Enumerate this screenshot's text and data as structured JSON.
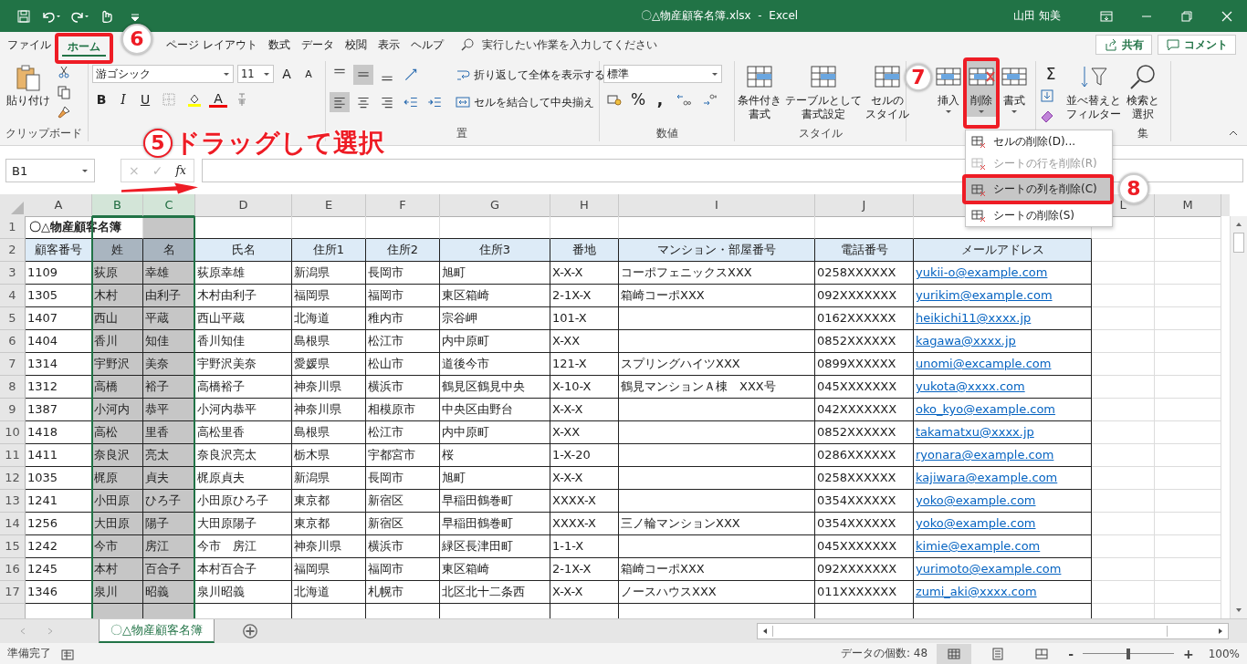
{
  "window": {
    "title": "〇△物産顧客名簿.xlsx  -  Excel",
    "user": "山田 知美"
  },
  "tabs": [
    {
      "label": "ファイル",
      "selected": false
    },
    {
      "label": "ホーム",
      "selected": true
    },
    {
      "label": "ページ レイアウト",
      "selected": false
    },
    {
      "label": "数式",
      "selected": false
    },
    {
      "label": "データ",
      "selected": false
    },
    {
      "label": "校閲",
      "selected": false
    },
    {
      "label": "表示",
      "selected": false
    },
    {
      "label": "ヘルプ",
      "selected": false
    }
  ],
  "tell_me": {
    "placeholder": "実行したい作業を入力してください"
  },
  "share": "共有",
  "comment": "コメント",
  "ribbon": {
    "clipboard": {
      "paste": "貼り付け",
      "label": "クリップボード"
    },
    "font": {
      "name": "游ゴシック",
      "size": "11",
      "grow": "A",
      "shrink": "A",
      "bold": "B",
      "italic": "I",
      "underline": "U",
      "font_color_label": "A"
    },
    "alignment": {
      "wrap": "折り返して全体を表示する",
      "merge": "セルを結合して中央揃え",
      "label": "置"
    },
    "number": {
      "format": "標準",
      "percent": "%",
      "comma": ",",
      "label": "数値"
    },
    "styles": {
      "buttons": [
        {
          "line1": "条件付き",
          "line2": "書式"
        },
        {
          "line1": "テーブルとして",
          "line2": "書式設定"
        },
        {
          "line1": "セルの",
          "line2": "スタイル"
        }
      ],
      "label": "スタイル"
    },
    "cells": {
      "buttons": [
        {
          "label": "挿入",
          "selected": false
        },
        {
          "label": "削除",
          "selected": true
        },
        {
          "label": "書式",
          "selected": false
        }
      ]
    },
    "editing": {
      "sum": "Σ",
      "sort": {
        "line1": "並べ替えと",
        "line2": "フィルター"
      },
      "find": {
        "line1": "検索と",
        "line2": "選択"
      },
      "label": "集"
    }
  },
  "delete_menu": [
    {
      "label": "セルの削除(D)...",
      "disabled": false,
      "selected": false
    },
    {
      "label": "シートの行を削除(R)",
      "disabled": true,
      "selected": false
    },
    {
      "label": "シートの列を削除(C)",
      "disabled": false,
      "selected": true
    },
    {
      "label": "シートの削除(S)",
      "disabled": false,
      "selected": false
    }
  ],
  "formula_bar": {
    "name_box": "B1",
    "cancel": "×",
    "enter": "✓",
    "fx": "fx"
  },
  "column_headers": [
    {
      "label": "A",
      "selected": false
    },
    {
      "label": "B",
      "selected": true
    },
    {
      "label": "C",
      "selected": true
    },
    {
      "label": "D",
      "selected": false
    },
    {
      "label": "E",
      "selected": false
    },
    {
      "label": "F",
      "selected": false
    },
    {
      "label": "G",
      "selected": false
    },
    {
      "label": "H",
      "selected": false
    },
    {
      "label": "I",
      "selected": false
    },
    {
      "label": "J",
      "selected": false
    },
    {
      "selected": false
    },
    {
      "label": "L",
      "selected": false
    },
    {
      "label": "M",
      "selected": false
    }
  ],
  "table": {
    "title_row": "1",
    "title": "〇△物産顧客名簿",
    "header_row": "2",
    "headers": [
      "顧客番号",
      "姓",
      "名",
      "氏名",
      "住所1",
      "住所2",
      "住所3",
      "番地",
      "マンション・部屋番号",
      "電話番号",
      "メールアドレス"
    ],
    "rows": [
      {
        "row": "3",
        "id": "1109",
        "last": "荻原",
        "first": "幸雄",
        "full": "荻原幸雄",
        "pref": "新潟県",
        "city": "長岡市",
        "addr": "旭町",
        "banchi": "X-X-X",
        "building": "コーポフェニックスXXX",
        "tel": "0258XXXXXX",
        "email": "yukii-o@example.com"
      },
      {
        "row": "4",
        "id": "1305",
        "last": "木村",
        "first": "由利子",
        "full": "木村由利子",
        "pref": "福岡県",
        "city": "福岡市",
        "addr": "東区箱崎",
        "banchi": "2-1X-X",
        "building": "箱崎コーポXXX",
        "tel": "092XXXXXXX",
        "email": "yurikim@example.com"
      },
      {
        "row": "5",
        "id": "1407",
        "last": "西山",
        "first": "平蔵",
        "full": "西山平蔵",
        "pref": "北海道",
        "city": "稚内市",
        "addr": "宗谷岬",
        "banchi": "101-X",
        "tel": "0162XXXXXX",
        "email": "heikichi11@xxxx.jp"
      },
      {
        "row": "6",
        "id": "1404",
        "last": "香川",
        "first": "知佳",
        "full": "香川知佳",
        "pref": "島根県",
        "city": "松江市",
        "addr": "内中原町",
        "banchi": "X-XX",
        "tel": "0852XXXXXX",
        "email": "kagawa@xxxx.jp"
      },
      {
        "row": "7",
        "id": "1314",
        "last": "宇野沢",
        "first": "美奈",
        "full": "宇野沢美奈",
        "pref": "愛媛県",
        "city": "松山市",
        "addr": "道後今市",
        "banchi": "121-X",
        "building": "スプリングハイツXXX",
        "tel": "0899XXXXXX",
        "email": "unomi@excample.com"
      },
      {
        "row": "8",
        "id": "1312",
        "last": "高橋",
        "first": "裕子",
        "full": "高橋裕子",
        "pref": "神奈川県",
        "city": "横浜市",
        "addr": "鶴見区鶴見中央",
        "banchi": "X-10-X",
        "building": "鶴見マンションＡ棟　XXX号",
        "tel": "045XXXXXXX",
        "email": "yukota@xxxx.com"
      },
      {
        "row": "9",
        "id": "1387",
        "last": "小河内",
        "first": "恭平",
        "full": "小河内恭平",
        "pref": "神奈川県",
        "city": "相模原市",
        "addr": "中央区由野台",
        "banchi": "X-X-X",
        "tel": "042XXXXXXX",
        "email": "oko_kyo@example.com"
      },
      {
        "row": "10",
        "id": "1418",
        "last": "高松",
        "first": "里香",
        "full": "高松里香",
        "pref": "島根県",
        "city": "松江市",
        "addr": "内中原町",
        "banchi": "X-XX",
        "tel": "0852XXXXXX",
        "email": "takamatxu@xxxx.jp"
      },
      {
        "row": "11",
        "id": "1411",
        "last": "奈良沢",
        "first": "亮太",
        "full": "奈良沢亮太",
        "pref": "栃木県",
        "city": "宇都宮市",
        "addr": "桜",
        "banchi": "1-X-20",
        "tel": "0286XXXXXX",
        "email": "ryonara@example.com"
      },
      {
        "row": "12",
        "id": "1035",
        "last": "梶原",
        "first": "貞夫",
        "full": "梶原貞夫",
        "pref": "新潟県",
        "city": "長岡市",
        "addr": "旭町",
        "banchi": "X-X-X",
        "tel": "0258XXXXXX",
        "email": "kajiwara@example.com"
      },
      {
        "row": "13",
        "id": "1241",
        "last": "小田原",
        "first": "ひろ子",
        "full": "小田原ひろ子",
        "pref": "東京都",
        "city": "新宿区",
        "addr": "早稲田鶴巻町",
        "banchi": "XXXX-X",
        "tel": "0354XXXXXX",
        "email": "yoko@example.com"
      },
      {
        "row": "14",
        "id": "1256",
        "last": "大田原",
        "first": "陽子",
        "full": "大田原陽子",
        "pref": "東京都",
        "city": "新宿区",
        "addr": "早稲田鶴巻町",
        "banchi": "XXXX-X",
        "building": "三ノ輪マンションXXX",
        "tel": "0354XXXXXX",
        "email": "yoko@example.com"
      },
      {
        "row": "15",
        "id": "1242",
        "last": "今市",
        "first": "房江",
        "full": "今市　房江",
        "pref": "神奈川県",
        "city": "横浜市",
        "addr": "緑区長津田町",
        "banchi": "1-1-X",
        "tel": "045XXXXXXX",
        "email": "kimie@example.com"
      },
      {
        "row": "16",
        "id": "1245",
        "last": "本村",
        "first": "百合子",
        "full": "本村百合子",
        "pref": "福岡県",
        "city": "福岡市",
        "addr": "東区箱崎",
        "banchi": "2-1X-X",
        "building": "箱崎コーポXXX",
        "tel": "092XXXXXXX",
        "email": "yurimoto@example.com"
      },
      {
        "row": "17",
        "id": "1346",
        "last": "泉川",
        "first": "昭義",
        "full": "泉川昭義",
        "pref": "北海道",
        "city": "札幌市",
        "addr": "北区北十二条西",
        "banchi": "X-X-X",
        "building": "ノースハウスXXX",
        "tel": "011XXXXXXX",
        "email": "zumi_aki@xxxx.com"
      }
    ]
  },
  "sheet_tabs": [
    {
      "label": "〇△物産顧客名簿",
      "selected": true
    }
  ],
  "status_bar": {
    "ready": "準備完了",
    "count": "データの個数: 48",
    "zoom_minus": "-",
    "zoom_plus": "+",
    "zoom": "100%",
    "zoom_level": {
      "level": 0.5
    }
  },
  "annotations": [
    {
      "kind": "circle",
      "number": "6"
    },
    {
      "kind": "label",
      "number": "5",
      "text": "ドラッグして選択"
    },
    {
      "kind": "arrow"
    },
    {
      "kind": "circle",
      "number": "7"
    },
    {
      "kind": "circle",
      "number": "8"
    },
    {
      "kind": "box"
    },
    {
      "kind": "box"
    },
    {
      "kind": "box"
    }
  ]
}
